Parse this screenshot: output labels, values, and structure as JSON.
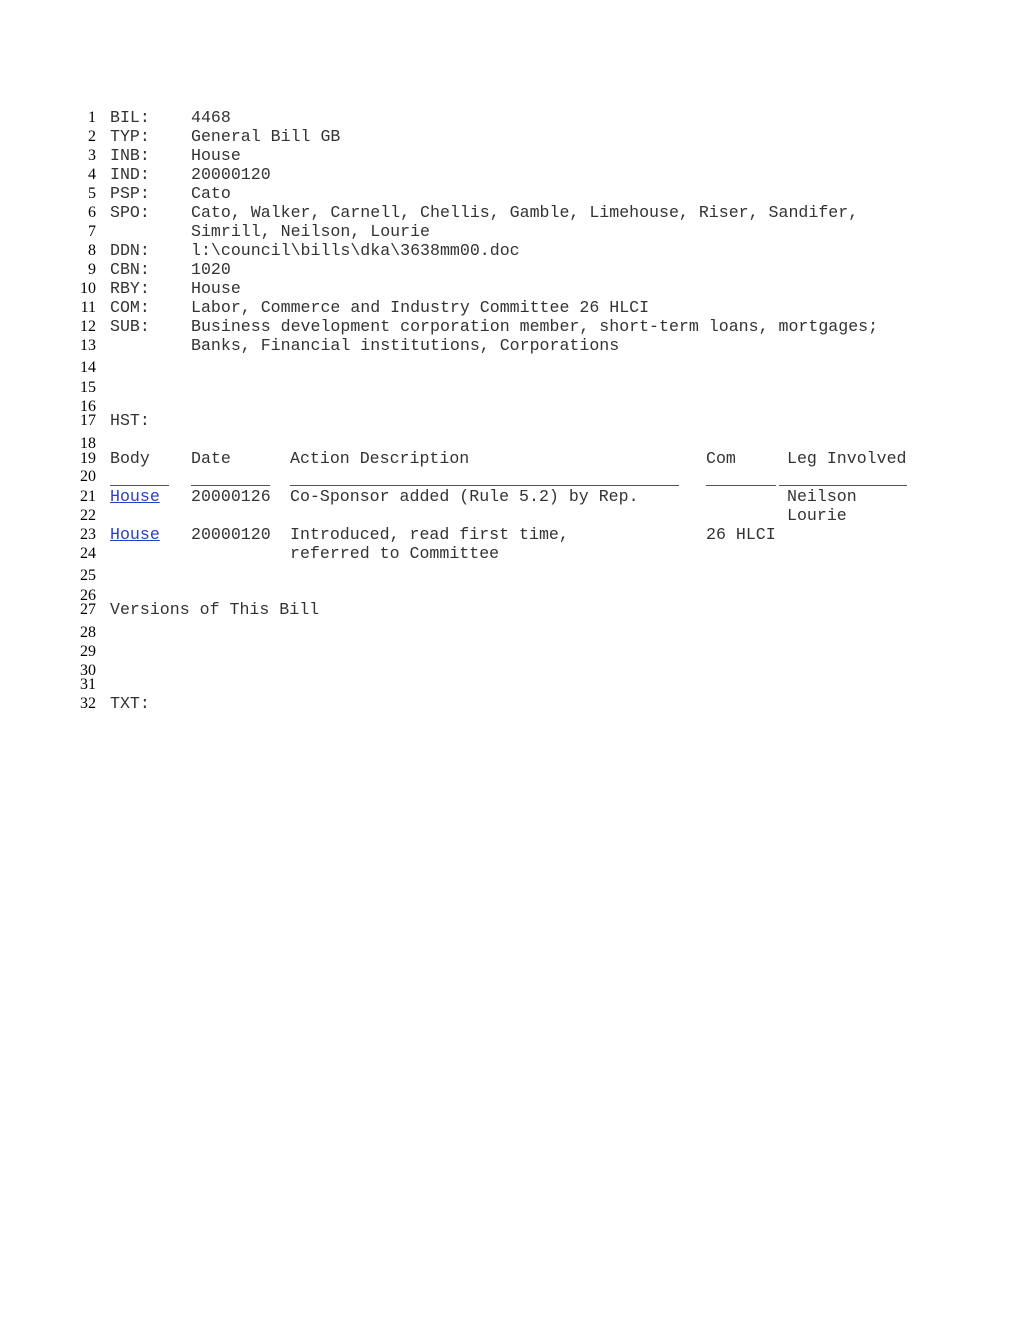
{
  "line_numbers": [
    "1",
    "2",
    "3",
    "4",
    "5",
    "6",
    "7",
    "8",
    "9",
    "10",
    "11",
    "12",
    "13",
    "14",
    "15",
    "16",
    "17",
    "18",
    "19",
    "20",
    "21",
    "22",
    "23",
    "24",
    "25",
    "26",
    "27",
    "28",
    "29",
    "30",
    "31",
    "32"
  ],
  "fields": {
    "bil": {
      "label": "BIL:",
      "value": "4468"
    },
    "typ": {
      "label": "TYP:",
      "value": "General Bill GB"
    },
    "inb": {
      "label": "INB:",
      "value": "House"
    },
    "ind": {
      "label": "IND:",
      "value": "20000120"
    },
    "psp": {
      "label": "PSP:",
      "value": "Cato"
    },
    "spo": {
      "label": "SPO:",
      "value": "Cato, Walker, Carnell, Chellis, Gamble, Limehouse, Riser, Sandifer,",
      "value2": "Simrill, Neilson, Lourie"
    },
    "ddn": {
      "label": "DDN:",
      "value": "l:\\council\\bills\\dka\\3638mm00.doc"
    },
    "cbn": {
      "label": "CBN:",
      "value": "1020"
    },
    "rby": {
      "label": "RBY:",
      "value": "House"
    },
    "com": {
      "label": "COM:",
      "value": "Labor, Commerce and Industry Committee 26 HLCI"
    },
    "sub": {
      "label": "SUB:",
      "value": "Business development corporation member, short-term loans, mortgages;",
      "value2": "Banks, Financial institutions, Corporations"
    }
  },
  "history": {
    "label": "HST:",
    "headers": {
      "body": "Body",
      "date": "Date",
      "action": "Action Description",
      "com": "Com",
      "leg": "Leg Involved"
    },
    "rows": [
      {
        "body": "House",
        "date": "20000126",
        "action": [
          "Co-Sponsor added (Rule 5.2) by Rep."
        ],
        "com": "",
        "leg": [
          "Neilson",
          "Lourie"
        ]
      },
      {
        "body": "House",
        "date": "20000120",
        "action": [
          "Introduced, read first time,",
          "referred to Committee"
        ],
        "com": "26 HLCI",
        "leg": []
      }
    ]
  },
  "versions_label": "Versions of This Bill",
  "txt_label": "TXT:"
}
